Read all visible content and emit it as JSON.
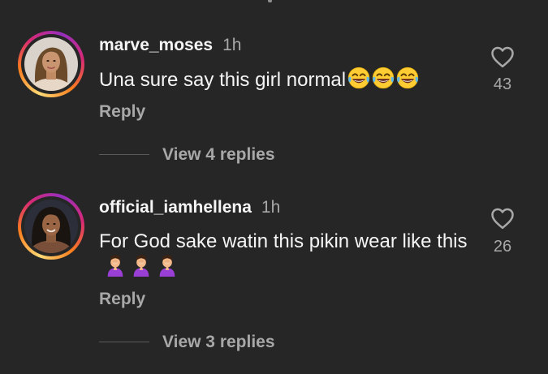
{
  "comments": [
    {
      "username": "marve_moses",
      "time": "1h",
      "text": "Una sure say this girl normal",
      "emojis": [
        "laugh-cry",
        "laugh-cry",
        "laugh-cry"
      ],
      "likes": "43",
      "reply_label": "Reply",
      "view_replies": "View 4 replies"
    },
    {
      "username": "official_iamhellena",
      "time": "1h",
      "text": "For God sake watin this pikin wear like this",
      "emojis": [
        "facepalm",
        "facepalm",
        "facepalm"
      ],
      "likes": "26",
      "reply_label": "Reply",
      "view_replies": "View 3 replies"
    }
  ],
  "colors": {
    "background": "#262626",
    "primary_text": "#f5f5f5",
    "secondary_text": "#a8a8a8",
    "story_ring": [
      "#feda75",
      "#fa7e1e",
      "#d62976",
      "#962fbf"
    ]
  }
}
